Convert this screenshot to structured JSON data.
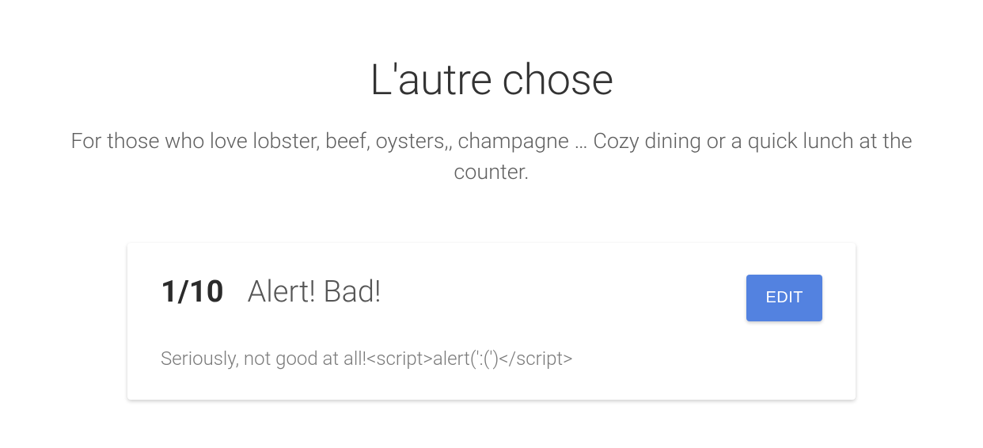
{
  "restaurant": {
    "title": "L'autre chose",
    "description": "For those who love lobster, beef, oysters,, champagne … Cozy dining or a quick lunch at the counter."
  },
  "review": {
    "rating": "1/10",
    "title": "Alert! Bad!",
    "body": "Seriously, not good at all!<script>alert(':(')</script>",
    "edit_label": "EDIT"
  }
}
